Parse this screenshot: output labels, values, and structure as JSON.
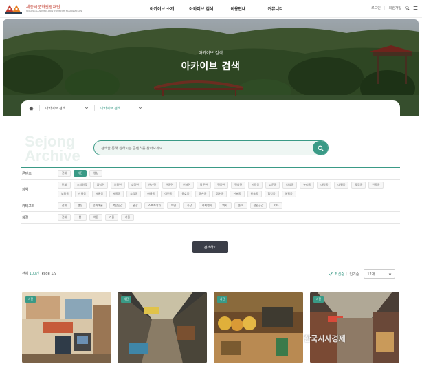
{
  "header": {
    "logo_text": "세종시문화관광재단",
    "logo_sub": "SEJONG CULTURE AND TOURISM FOUNDATION",
    "nav": [
      "아카이브 소개",
      "아카이브 검색",
      "이용안내",
      "커뮤니티"
    ],
    "login": "로그인",
    "signup": "회원가입"
  },
  "hero": {
    "subtitle": "아카이브 검색",
    "title": "아카이브 검색"
  },
  "breadcrumb": {
    "level1": "아카이브 검색",
    "level2": "아카이브 검색"
  },
  "search": {
    "placeholder": "검색을 통해 원하시는 콘텐츠를 찾아보세요.",
    "watermark_line1": "Sejong",
    "watermark_line2": "Archive"
  },
  "filters": [
    {
      "label": "콘텐츠",
      "chips": [
        {
          "text": "전체",
          "on": false
        },
        {
          "text": "사진",
          "on": true
        },
        {
          "text": "영상",
          "on": false
        }
      ]
    },
    {
      "label": "지역",
      "chips": [
        {
          "text": "전체"
        },
        {
          "text": "조치원읍"
        },
        {
          "text": "금남면"
        },
        {
          "text": "부강면"
        },
        {
          "text": "소정면"
        },
        {
          "text": "연기면"
        },
        {
          "text": "연동면"
        },
        {
          "text": "연서면"
        },
        {
          "text": "장군면"
        },
        {
          "text": "전동면"
        },
        {
          "text": "전의면"
        },
        {
          "text": "가람동"
        },
        {
          "text": "고운동"
        },
        {
          "text": "나성동"
        },
        {
          "text": "누리동"
        },
        {
          "text": "다정동"
        },
        {
          "text": "대평동"
        },
        {
          "text": "도담동"
        },
        {
          "text": "반곡동"
        },
        {
          "text": "보람동"
        },
        {
          "text": "산울동"
        },
        {
          "text": "새롬동"
        },
        {
          "text": "세종동"
        },
        {
          "text": "소담동"
        },
        {
          "text": "아름동"
        },
        {
          "text": "어진동"
        },
        {
          "text": "용호동"
        },
        {
          "text": "종촌동"
        },
        {
          "text": "집현동"
        },
        {
          "text": "한별동"
        },
        {
          "text": "한솔동"
        },
        {
          "text": "합강동"
        },
        {
          "text": "해밀동"
        }
      ]
    },
    {
      "label": "카테고리",
      "chips": [
        {
          "text": "전체"
        },
        {
          "text": "행정"
        },
        {
          "text": "문화예술"
        },
        {
          "text": "복합공간"
        },
        {
          "text": "관광"
        },
        {
          "text": "스포츠여가"
        },
        {
          "text": "자연"
        },
        {
          "text": "시장"
        },
        {
          "text": "축제행사"
        },
        {
          "text": "역사"
        },
        {
          "text": "종교"
        },
        {
          "text": "생활공간"
        },
        {
          "text": "기타"
        }
      ]
    },
    {
      "label": "계절",
      "chips": [
        {
          "text": "전체"
        },
        {
          "text": "봄"
        },
        {
          "text": "여름"
        },
        {
          "text": "가을"
        },
        {
          "text": "겨울"
        }
      ]
    }
  ],
  "submit_label": "검색하기",
  "results": {
    "total_prefix": "전체",
    "total": "100건",
    "page_info": "Page 1/9"
  },
  "sort": {
    "recent": "최신순",
    "popular": "인기순",
    "per_page": "12개"
  },
  "cards": [
    {
      "badge": "사진"
    },
    {
      "badge": "사진"
    },
    {
      "badge": "사진"
    },
    {
      "badge": "사진"
    }
  ],
  "photo_credit": "한국시사경제"
}
